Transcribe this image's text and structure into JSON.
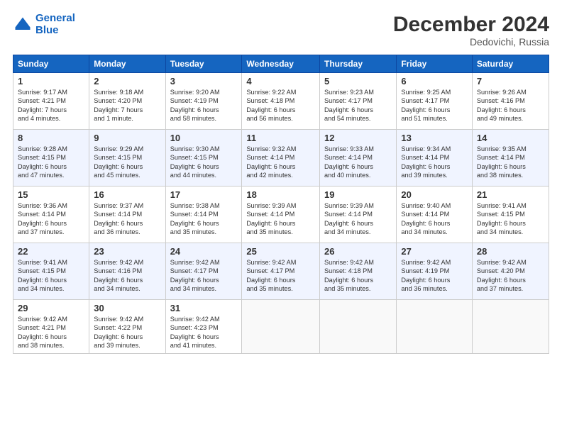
{
  "header": {
    "logo_line1": "General",
    "logo_line2": "Blue",
    "month": "December 2024",
    "location": "Dedovichi, Russia"
  },
  "days_of_week": [
    "Sunday",
    "Monday",
    "Tuesday",
    "Wednesday",
    "Thursday",
    "Friday",
    "Saturday"
  ],
  "weeks": [
    [
      {
        "day": "1",
        "info": "Sunrise: 9:17 AM\nSunset: 4:21 PM\nDaylight: 7 hours\nand 4 minutes."
      },
      {
        "day": "2",
        "info": "Sunrise: 9:18 AM\nSunset: 4:20 PM\nDaylight: 7 hours\nand 1 minute."
      },
      {
        "day": "3",
        "info": "Sunrise: 9:20 AM\nSunset: 4:19 PM\nDaylight: 6 hours\nand 58 minutes."
      },
      {
        "day": "4",
        "info": "Sunrise: 9:22 AM\nSunset: 4:18 PM\nDaylight: 6 hours\nand 56 minutes."
      },
      {
        "day": "5",
        "info": "Sunrise: 9:23 AM\nSunset: 4:17 PM\nDaylight: 6 hours\nand 54 minutes."
      },
      {
        "day": "6",
        "info": "Sunrise: 9:25 AM\nSunset: 4:17 PM\nDaylight: 6 hours\nand 51 minutes."
      },
      {
        "day": "7",
        "info": "Sunrise: 9:26 AM\nSunset: 4:16 PM\nDaylight: 6 hours\nand 49 minutes."
      }
    ],
    [
      {
        "day": "8",
        "info": "Sunrise: 9:28 AM\nSunset: 4:15 PM\nDaylight: 6 hours\nand 47 minutes."
      },
      {
        "day": "9",
        "info": "Sunrise: 9:29 AM\nSunset: 4:15 PM\nDaylight: 6 hours\nand 45 minutes."
      },
      {
        "day": "10",
        "info": "Sunrise: 9:30 AM\nSunset: 4:15 PM\nDaylight: 6 hours\nand 44 minutes."
      },
      {
        "day": "11",
        "info": "Sunrise: 9:32 AM\nSunset: 4:14 PM\nDaylight: 6 hours\nand 42 minutes."
      },
      {
        "day": "12",
        "info": "Sunrise: 9:33 AM\nSunset: 4:14 PM\nDaylight: 6 hours\nand 40 minutes."
      },
      {
        "day": "13",
        "info": "Sunrise: 9:34 AM\nSunset: 4:14 PM\nDaylight: 6 hours\nand 39 minutes."
      },
      {
        "day": "14",
        "info": "Sunrise: 9:35 AM\nSunset: 4:14 PM\nDaylight: 6 hours\nand 38 minutes."
      }
    ],
    [
      {
        "day": "15",
        "info": "Sunrise: 9:36 AM\nSunset: 4:14 PM\nDaylight: 6 hours\nand 37 minutes."
      },
      {
        "day": "16",
        "info": "Sunrise: 9:37 AM\nSunset: 4:14 PM\nDaylight: 6 hours\nand 36 minutes."
      },
      {
        "day": "17",
        "info": "Sunrise: 9:38 AM\nSunset: 4:14 PM\nDaylight: 6 hours\nand 35 minutes."
      },
      {
        "day": "18",
        "info": "Sunrise: 9:39 AM\nSunset: 4:14 PM\nDaylight: 6 hours\nand 35 minutes."
      },
      {
        "day": "19",
        "info": "Sunrise: 9:39 AM\nSunset: 4:14 PM\nDaylight: 6 hours\nand 34 minutes."
      },
      {
        "day": "20",
        "info": "Sunrise: 9:40 AM\nSunset: 4:14 PM\nDaylight: 6 hours\nand 34 minutes."
      },
      {
        "day": "21",
        "info": "Sunrise: 9:41 AM\nSunset: 4:15 PM\nDaylight: 6 hours\nand 34 minutes."
      }
    ],
    [
      {
        "day": "22",
        "info": "Sunrise: 9:41 AM\nSunset: 4:15 PM\nDaylight: 6 hours\nand 34 minutes."
      },
      {
        "day": "23",
        "info": "Sunrise: 9:42 AM\nSunset: 4:16 PM\nDaylight: 6 hours\nand 34 minutes."
      },
      {
        "day": "24",
        "info": "Sunrise: 9:42 AM\nSunset: 4:17 PM\nDaylight: 6 hours\nand 34 minutes."
      },
      {
        "day": "25",
        "info": "Sunrise: 9:42 AM\nSunset: 4:17 PM\nDaylight: 6 hours\nand 35 minutes."
      },
      {
        "day": "26",
        "info": "Sunrise: 9:42 AM\nSunset: 4:18 PM\nDaylight: 6 hours\nand 35 minutes."
      },
      {
        "day": "27",
        "info": "Sunrise: 9:42 AM\nSunset: 4:19 PM\nDaylight: 6 hours\nand 36 minutes."
      },
      {
        "day": "28",
        "info": "Sunrise: 9:42 AM\nSunset: 4:20 PM\nDaylight: 6 hours\nand 37 minutes."
      }
    ],
    [
      {
        "day": "29",
        "info": "Sunrise: 9:42 AM\nSunset: 4:21 PM\nDaylight: 6 hours\nand 38 minutes."
      },
      {
        "day": "30",
        "info": "Sunrise: 9:42 AM\nSunset: 4:22 PM\nDaylight: 6 hours\nand 39 minutes."
      },
      {
        "day": "31",
        "info": "Sunrise: 9:42 AM\nSunset: 4:23 PM\nDaylight: 6 hours\nand 41 minutes."
      },
      {
        "day": "",
        "info": ""
      },
      {
        "day": "",
        "info": ""
      },
      {
        "day": "",
        "info": ""
      },
      {
        "day": "",
        "info": ""
      }
    ]
  ]
}
